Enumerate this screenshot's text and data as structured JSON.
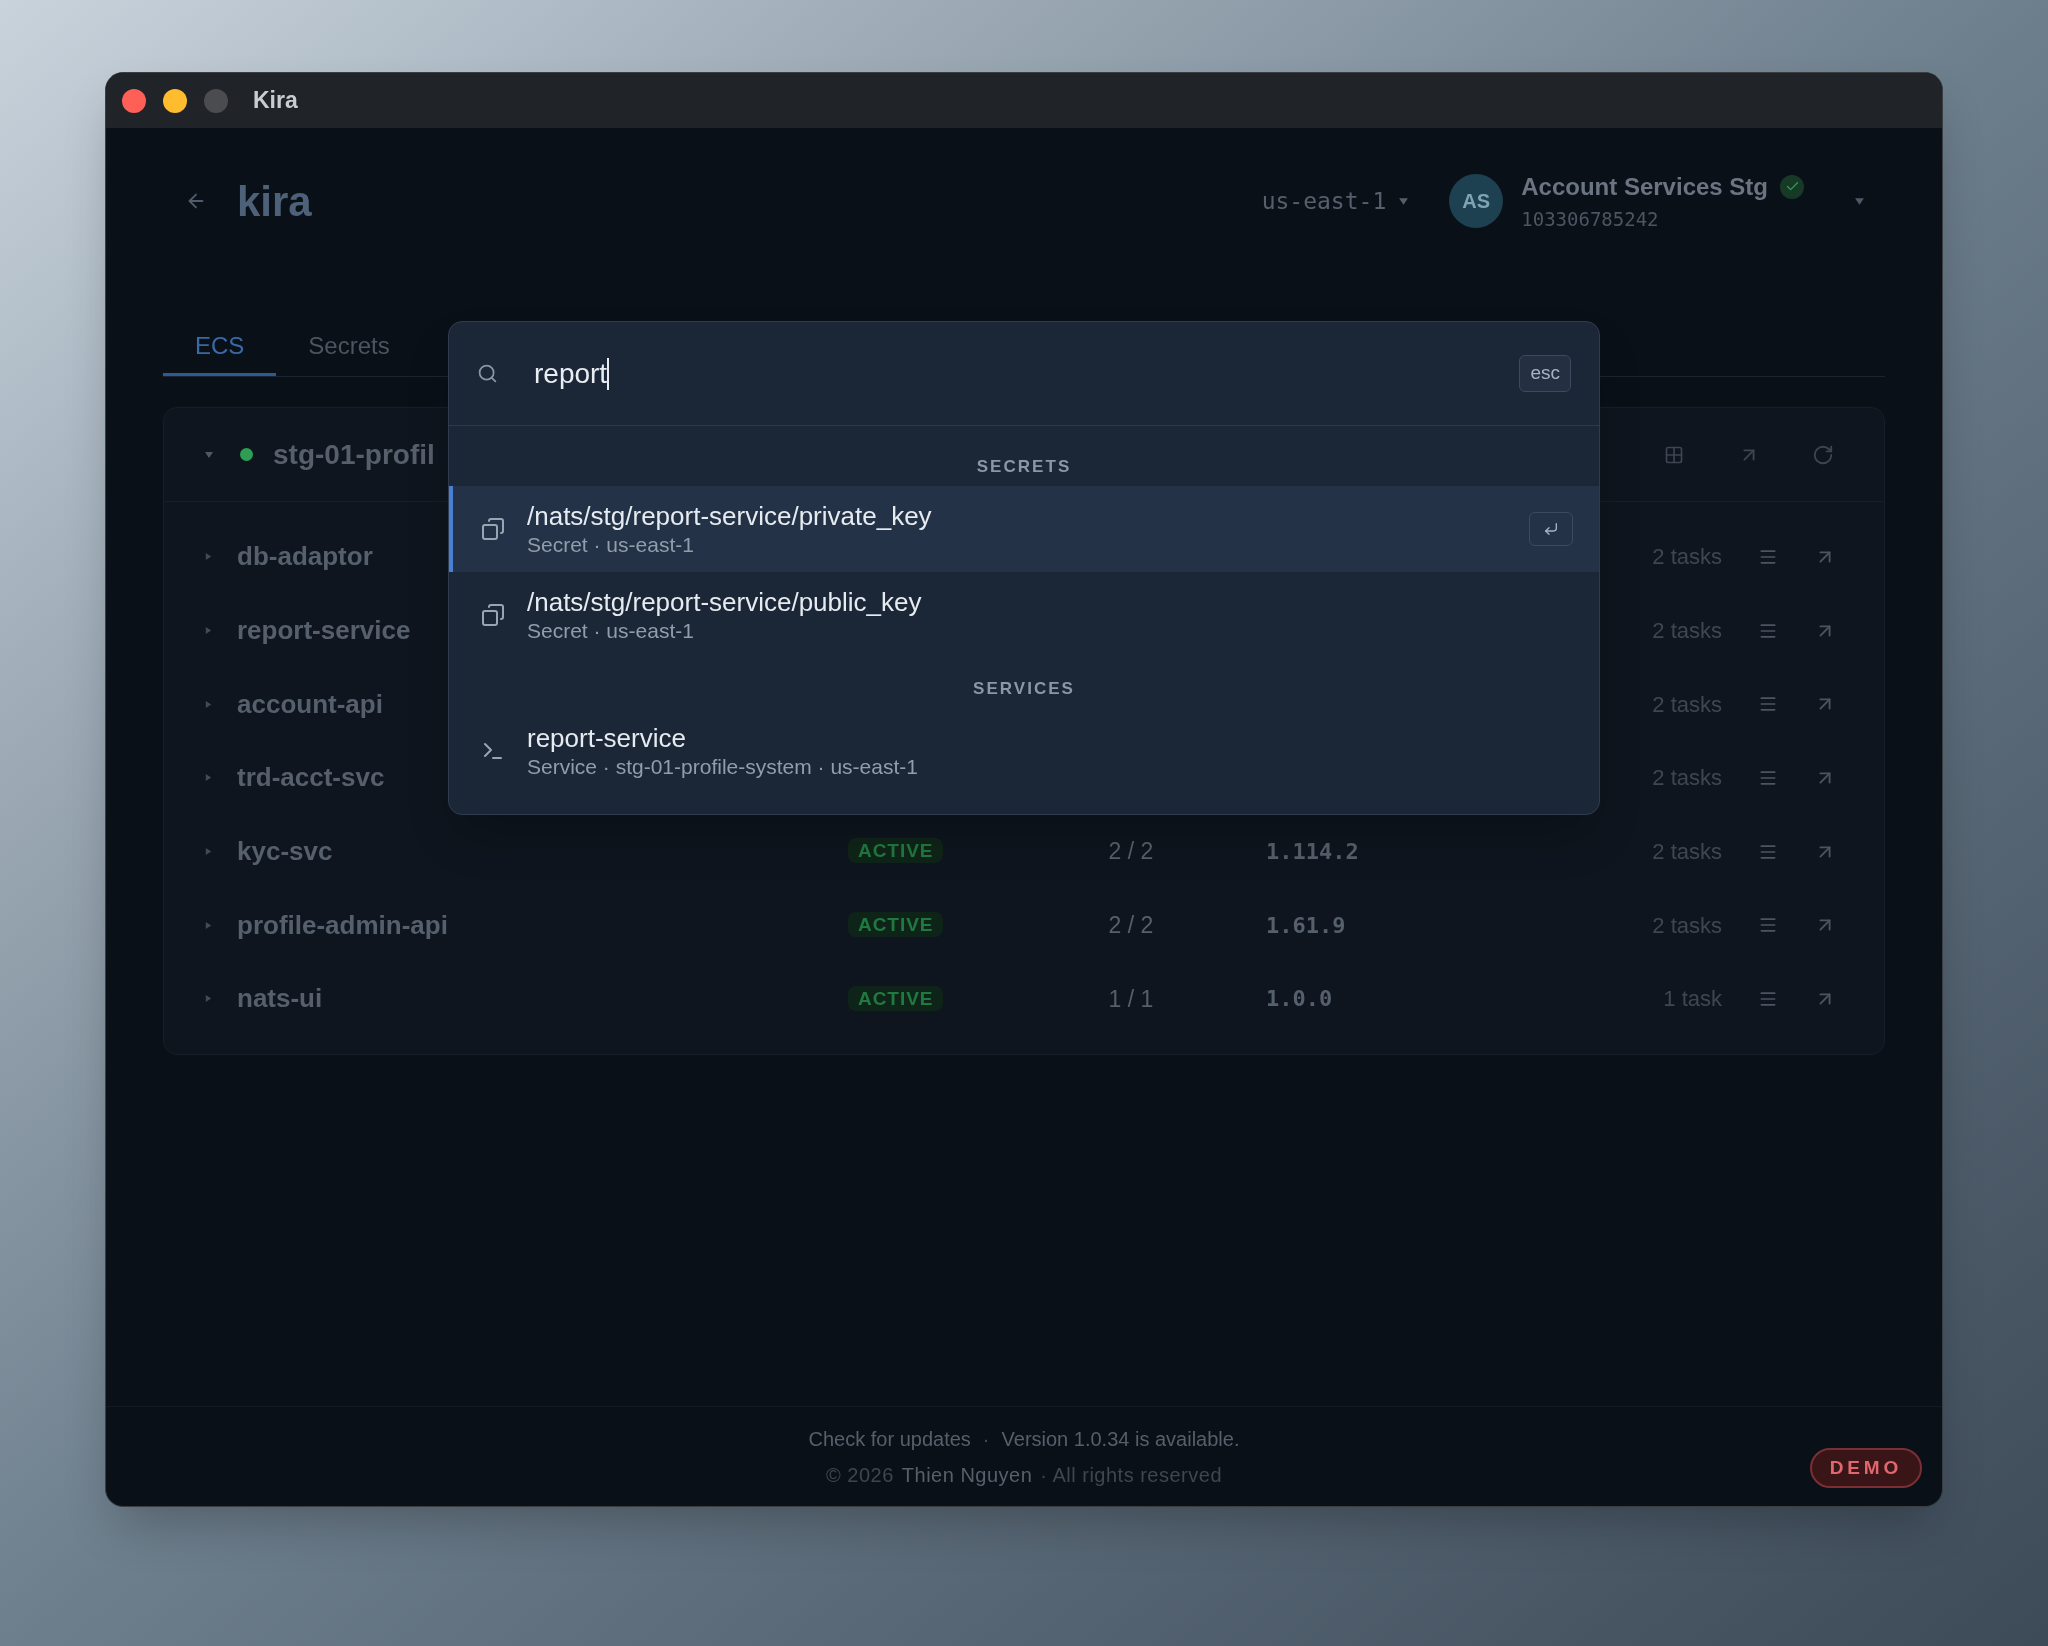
{
  "window": {
    "title": "Kira"
  },
  "header": {
    "title": "kira",
    "region": "us-east-1",
    "account": {
      "initials": "AS",
      "name": "Account Services Stg",
      "id": "103306785242",
      "verified": true
    }
  },
  "tabs": [
    {
      "label": "ECS",
      "selected": true
    },
    {
      "label": "Secrets",
      "selected": false
    }
  ],
  "cluster": {
    "name": "stg-01-profil",
    "expanded": true,
    "services": [
      {
        "name": "db-adaptor",
        "tasks": "2 tasks"
      },
      {
        "name": "report-service",
        "tasks": "2 tasks"
      },
      {
        "name": "account-api",
        "tasks": "2 tasks"
      },
      {
        "name": "trd-acct-svc",
        "tasks": "2 tasks"
      },
      {
        "name": "kyc-svc",
        "status": "ACTIVE",
        "count": "2 / 2",
        "version": "1.114.2",
        "tasks": "2 tasks"
      },
      {
        "name": "profile-admin-api",
        "status": "ACTIVE",
        "count": "2 / 2",
        "version": "1.61.9",
        "tasks": "2 tasks"
      },
      {
        "name": "nats-ui",
        "status": "ACTIVE",
        "count": "1 / 1",
        "version": "1.0.0",
        "tasks": "1 task"
      }
    ]
  },
  "palette": {
    "query": "report",
    "esc_key": "esc",
    "sections": [
      {
        "heading": "SECRETS",
        "items": [
          {
            "kind": "secret",
            "title": "/nats/stg/report-service/private_key",
            "subtitle": "Secret · us-east-1",
            "selected": true
          },
          {
            "kind": "secret",
            "title": "/nats/stg/report-service/public_key",
            "subtitle": "Secret · us-east-1",
            "selected": false
          }
        ]
      },
      {
        "heading": "SERVICES",
        "items": [
          {
            "kind": "service",
            "title": "report-service",
            "subtitle": "Service · stg-01-profile-system · us-east-1",
            "selected": false
          }
        ]
      }
    ]
  },
  "footer": {
    "update_link": "Check for updates",
    "separator": "·",
    "update_note": "Version 1.0.34 is available.",
    "copyright": "© 2026",
    "author": "Thien Nguyen",
    "rights": "· All rights reserved",
    "badge": "DEMO"
  }
}
